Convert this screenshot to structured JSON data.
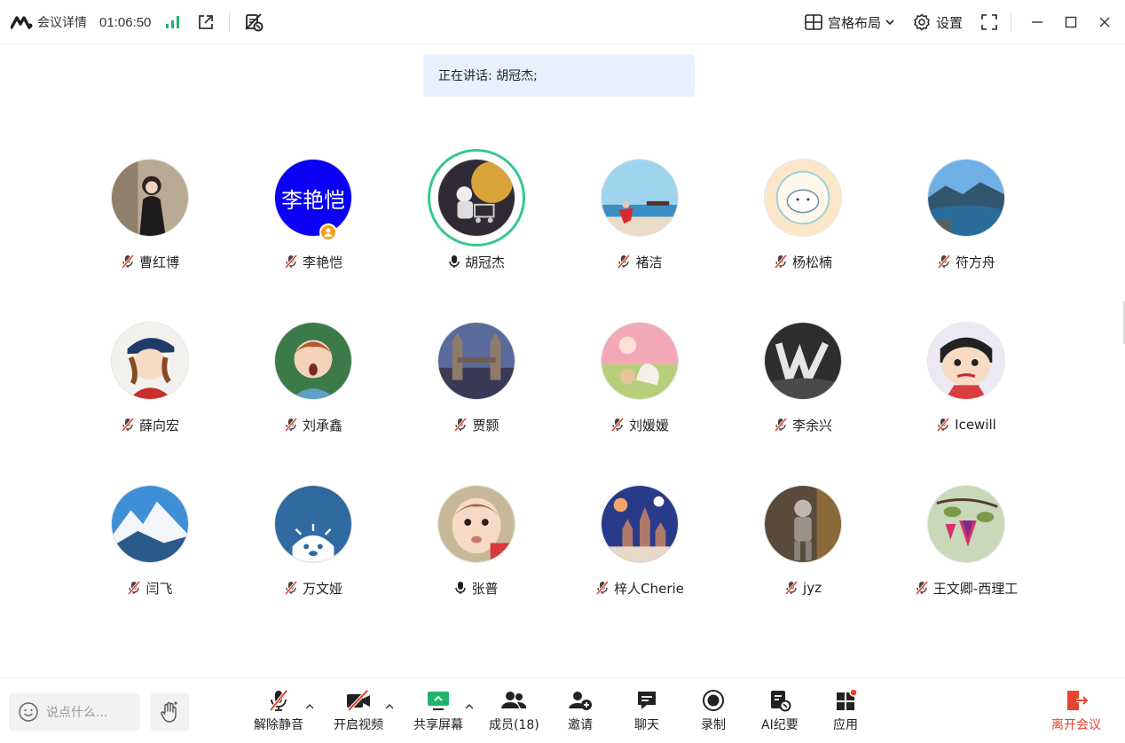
{
  "titlebar": {
    "meeting_details": "会议详情",
    "timer": "01:06:50",
    "layout_label": "宫格布局",
    "settings_label": "设置"
  },
  "speaking": {
    "text": "正在讲话: 胡冠杰;"
  },
  "participants": [
    {
      "name": "曹红博",
      "mic": "muted"
    },
    {
      "name": "李艳恺",
      "mic": "muted",
      "avatar_text": "李艳恺"
    },
    {
      "name": "胡冠杰",
      "mic": "on"
    },
    {
      "name": "褚洁",
      "mic": "muted"
    },
    {
      "name": "杨松楠",
      "mic": "muted"
    },
    {
      "name": "符方舟",
      "mic": "muted"
    },
    {
      "name": "薛向宏",
      "mic": "muted"
    },
    {
      "name": "刘承鑫",
      "mic": "muted"
    },
    {
      "name": "贾颢",
      "mic": "muted"
    },
    {
      "name": "刘媛媛",
      "mic": "muted"
    },
    {
      "name": "李余兴",
      "mic": "muted"
    },
    {
      "name": "Icewill",
      "mic": "muted"
    },
    {
      "name": "闫飞",
      "mic": "muted"
    },
    {
      "name": "万文娅",
      "mic": "muted"
    },
    {
      "name": "张普",
      "mic": "on"
    },
    {
      "name": "梓人Cherie",
      "mic": "muted"
    },
    {
      "name": "jyz",
      "mic": "muted"
    },
    {
      "name": "王文卿-西理工",
      "mic": "muted"
    }
  ],
  "toolbar": {
    "chat_placeholder": "说点什么...",
    "unmute": "解除静音",
    "start_video": "开启视频",
    "share_screen": "共享屏幕",
    "members": "成员(18)",
    "invite": "邀请",
    "chat": "聊天",
    "record": "录制",
    "ai_summary": "AI纪要",
    "apps": "应用",
    "leave": "离开会议"
  },
  "colors": {
    "speaking_ring": "#36c98a",
    "banner_bg": "#e8f0fd",
    "muted_slash": "#e8432e",
    "leave": "#e8432e",
    "share_green": "#22b36b",
    "signal_green": "#22b36b",
    "host_badge": "#f3a21a",
    "text_avatar_bg": "#0b00f5"
  }
}
